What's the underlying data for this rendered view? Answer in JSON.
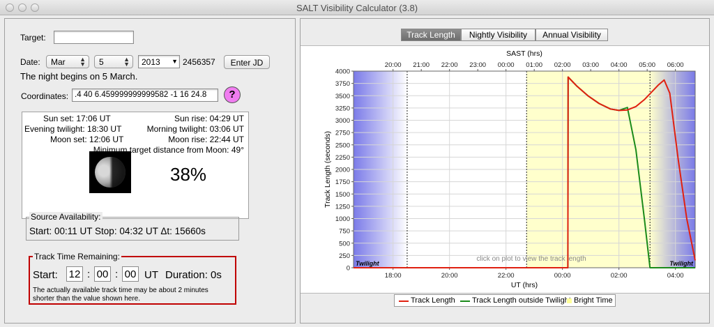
{
  "window": {
    "title": "SALT Visibility Calculator (3.8)"
  },
  "left": {
    "target_label": "Target:",
    "target_value": "",
    "date_label": "Date:",
    "month": "Mar",
    "day": "5",
    "year": "2013",
    "jd_value": "2456357",
    "enter_jd_label": "Enter JD",
    "night_begins": "The night begins on 5 March.",
    "coordinates_label": "Coordinates:",
    "coordinates_value": ".4 40 6.459999999999582 -1 16 24.8",
    "help_label": "?",
    "sun_set": "Sun set: 17:06 UT",
    "sun_rise": "Sun rise: 04:29 UT",
    "evening_twilight": "Evening twilight: 18:30 UT",
    "morning_twilight": "Morning twilight: 03:06 UT",
    "moon_set": "Moon set: 12:06 UT",
    "moon_rise": "Moon rise: 22:44 UT",
    "min_moon_distance": "Minimum target distance from Moon: 49°",
    "moon_phase": "38%",
    "source_availability": {
      "title": "Source Availability:",
      "text": "Start: 00:11 UT Stop: 04:32 UT Δt: 15660s"
    },
    "track_time": {
      "title": "Track Time Remaining:",
      "start_label": "Start:",
      "hh": "12",
      "mm": "00",
      "ss": "00",
      "sep": ":",
      "ut_label": "UT",
      "duration": "Duration: 0s",
      "note_line1": "The actually available track time may be about 2 minutes",
      "note_line2": "shorter than the value shown here."
    }
  },
  "right": {
    "tabs": [
      {
        "label": "Track Length",
        "active": true
      },
      {
        "label": "Nightly Visibility",
        "active": false
      },
      {
        "label": "Annual Visibility",
        "active": false
      }
    ]
  },
  "chart_data": {
    "type": "line",
    "title": "",
    "xlabel": "UT (hrs)",
    "x2label": "SAST (hrs)",
    "ylabel": "Track Length (seconds)",
    "xlim": [
      16.6,
      28.7
    ],
    "ylim": [
      0,
      4000
    ],
    "x_ticks": [
      18,
      20,
      22,
      24,
      26,
      28
    ],
    "x_tick_labels": [
      "18:00",
      "20:00",
      "22:00",
      "00:00",
      "02:00",
      "04:00"
    ],
    "x2_ticks": [
      20,
      21,
      22,
      23,
      24,
      25,
      26,
      27,
      28,
      29,
      30
    ],
    "x2_tick_labels": [
      "20:00",
      "21:00",
      "22:00",
      "23:00",
      "00:00",
      "01:00",
      "02:00",
      "03:00",
      "04:00",
      "05:00",
      "06:00"
    ],
    "y_ticks": [
      0,
      250,
      500,
      750,
      1000,
      1250,
      1500,
      1750,
      2000,
      2250,
      2500,
      2750,
      3000,
      3250,
      3500,
      3750,
      4000
    ],
    "y_tick_labels": [
      "0",
      "250",
      "500",
      "750",
      "1000",
      "1250",
      "1500",
      "1750",
      "2000",
      "2250",
      "2500",
      "2750",
      "3000",
      "3250",
      "3500",
      "3750",
      "4000"
    ],
    "grid": true,
    "series": [
      {
        "name": "Track Length",
        "color": "#e02010",
        "x": [
          16.6,
          24.19,
          24.2,
          24.5,
          24.9,
          25.3,
          25.7,
          26.0,
          26.3,
          26.6,
          26.9,
          27.2,
          27.4,
          27.6,
          27.8,
          28.1,
          28.4,
          28.7
        ],
        "y": [
          0,
          0,
          3880,
          3700,
          3500,
          3340,
          3230,
          3200,
          3210,
          3280,
          3420,
          3600,
          3720,
          3820,
          3550,
          2200,
          1000,
          150
        ]
      },
      {
        "name": "Track Length outside Twilight",
        "color": "#1a8a1a",
        "x": [
          16.6,
          24.19,
          24.2,
          24.5,
          24.9,
          25.3,
          25.7,
          26.0,
          26.3,
          26.6,
          26.9,
          27.1,
          27.2,
          28.7
        ],
        "y": [
          0,
          0,
          3880,
          3700,
          3500,
          3340,
          3230,
          3200,
          3260,
          2400,
          1000,
          0,
          0,
          0
        ]
      }
    ],
    "bright_time": {
      "name": "Bright Time",
      "from": 22.73,
      "to": 28.7,
      "color": "#ffffcc"
    },
    "twilight_label": "Twilight",
    "evening_twilight_ut": 18.5,
    "morning_twilight_ut": 27.1,
    "marker_line_ut": 22.73,
    "plot_hint": "click on plot to view the track length",
    "legend_position": "bottom"
  }
}
